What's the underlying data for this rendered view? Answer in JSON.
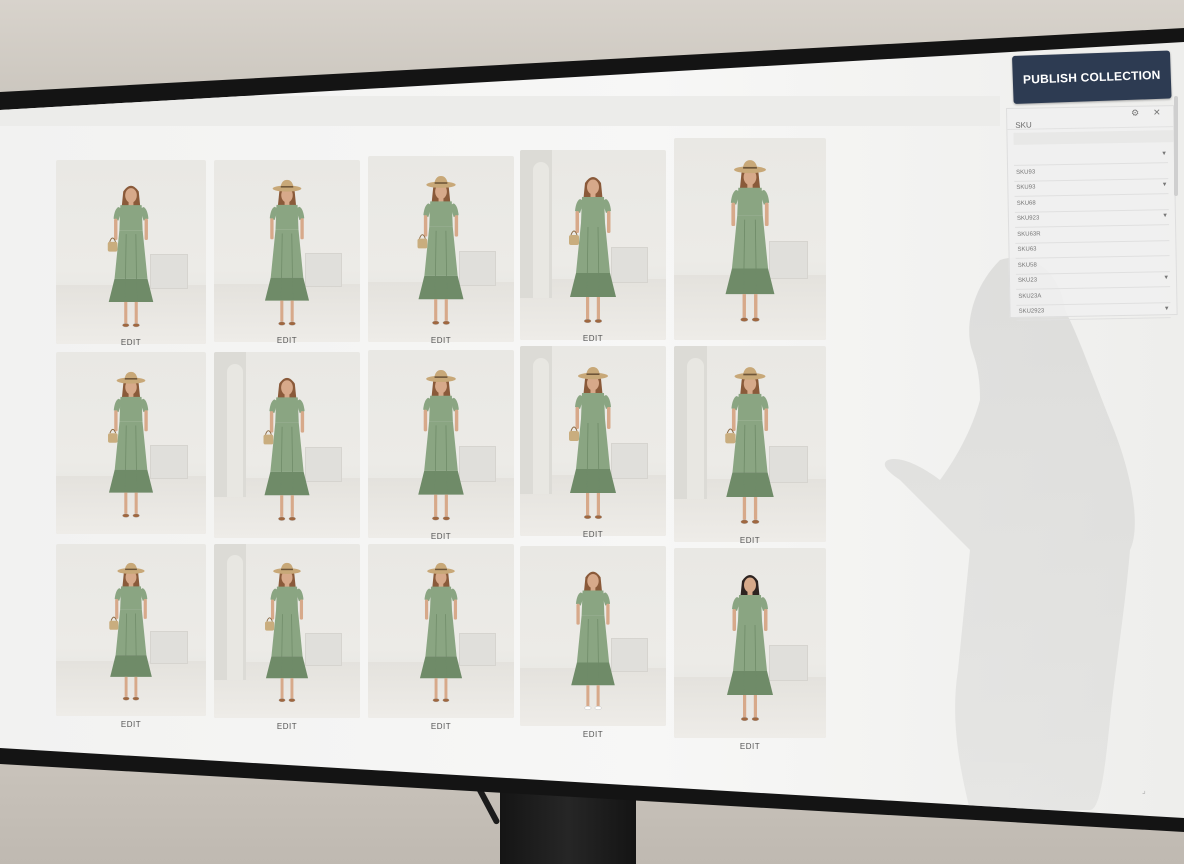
{
  "actions": {
    "publish_label": "PUBLISH COLLECTION"
  },
  "filter_panel": {
    "title": "SKU",
    "settings_icon": "gear-icon",
    "close_icon": "close-icon",
    "search_placeholder": "",
    "rows": [
      {
        "label": "",
        "has_chevron": true
      },
      {
        "label": "SKU93",
        "has_chevron": false
      },
      {
        "label": "SKU93",
        "has_chevron": true
      },
      {
        "label": "SKU68",
        "has_chevron": false
      },
      {
        "label": "SKU923",
        "has_chevron": true
      },
      {
        "label": "SKU63R",
        "has_chevron": false
      },
      {
        "label": "SKU63",
        "has_chevron": false
      },
      {
        "label": "SKU58",
        "has_chevron": false
      },
      {
        "label": "SKU23",
        "has_chevron": true
      },
      {
        "label": "SKU23A",
        "has_chevron": false
      },
      {
        "label": "SKU2923",
        "has_chevron": true
      }
    ]
  },
  "grid": {
    "item_label": "EDIT",
    "items": [
      {
        "row": 1,
        "col": 1,
        "label": "EDIT",
        "hat": false,
        "bag": true,
        "arch": false,
        "hair": "light",
        "shoes": "sandal"
      },
      {
        "row": 1,
        "col": 2,
        "label": "EDIT",
        "hat": true,
        "bag": false,
        "arch": false,
        "hair": "light",
        "shoes": "sandal"
      },
      {
        "row": 1,
        "col": 3,
        "label": "EDIT",
        "hat": true,
        "bag": true,
        "arch": false,
        "hair": "light",
        "shoes": "sandal"
      },
      {
        "row": 1,
        "col": 4,
        "label": "EDIT",
        "hat": false,
        "bag": true,
        "arch": true,
        "hair": "light",
        "shoes": "sandal"
      },
      {
        "row": 1,
        "col": 5,
        "label": "",
        "hat": true,
        "bag": false,
        "arch": false,
        "hair": "light",
        "shoes": "sandal"
      },
      {
        "row": 2,
        "col": 1,
        "label": "",
        "hat": true,
        "bag": true,
        "arch": false,
        "hair": "light",
        "shoes": "sandal"
      },
      {
        "row": 2,
        "col": 2,
        "label": "",
        "hat": false,
        "bag": true,
        "arch": true,
        "hair": "light",
        "shoes": "sandal"
      },
      {
        "row": 2,
        "col": 3,
        "label": "EDIT",
        "hat": true,
        "bag": false,
        "arch": false,
        "hair": "light",
        "shoes": "sandal"
      },
      {
        "row": 2,
        "col": 4,
        "label": "EDIT",
        "hat": true,
        "bag": true,
        "arch": true,
        "hair": "light",
        "shoes": "sandal"
      },
      {
        "row": 2,
        "col": 5,
        "label": "EDIT",
        "hat": true,
        "bag": true,
        "arch": true,
        "hair": "light",
        "shoes": "sandal"
      },
      {
        "row": 3,
        "col": 1,
        "label": "EDIT",
        "hat": true,
        "bag": true,
        "arch": false,
        "hair": "light",
        "shoes": "sandal"
      },
      {
        "row": 3,
        "col": 2,
        "label": "EDIT",
        "hat": true,
        "bag": true,
        "arch": true,
        "hair": "light",
        "shoes": "sandal"
      },
      {
        "row": 3,
        "col": 3,
        "label": "EDIT",
        "hat": true,
        "bag": false,
        "arch": false,
        "hair": "light",
        "shoes": "sandal"
      },
      {
        "row": 3,
        "col": 4,
        "label": "EDIT",
        "hat": false,
        "bag": false,
        "arch": false,
        "hair": "light",
        "shoes": "sneaker"
      },
      {
        "row": 3,
        "col": 5,
        "label": "EDIT",
        "hat": false,
        "bag": false,
        "arch": false,
        "hair": "dark",
        "shoes": "sandal"
      }
    ]
  },
  "colors": {
    "dress": "#8aa582",
    "dress_shadow": "#6f8b68",
    "hat": "#c8a878",
    "bag": "#c9ad7e",
    "skin": "#d7a98a",
    "hair_light": "#8a5a3a",
    "hair_dark": "#2e2320",
    "button_bg": "#2d3b52"
  }
}
